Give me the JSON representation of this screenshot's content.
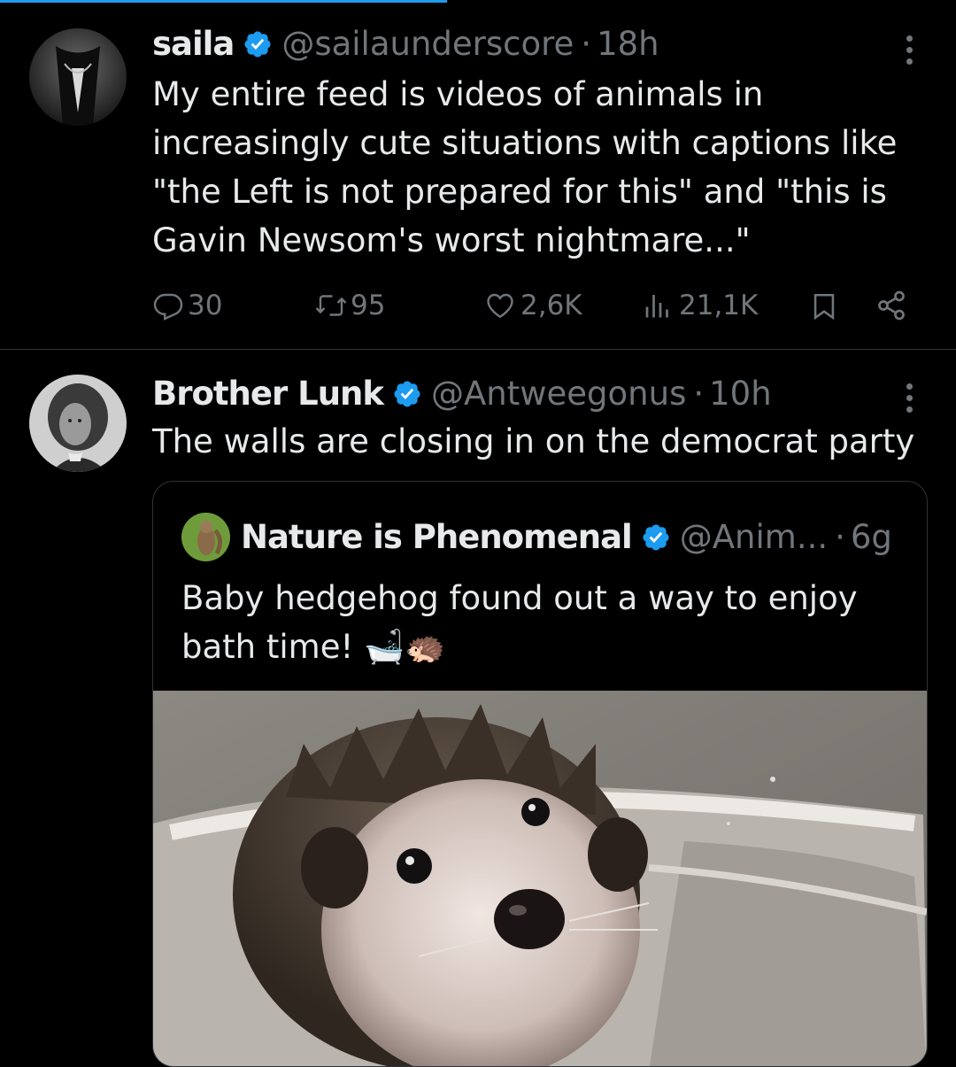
{
  "theme": {
    "background": "#000000",
    "accent": "#1d9bf0",
    "text": "#e7e9ea",
    "muted": "#71767b",
    "border": "#2f3336"
  },
  "tweets": [
    {
      "name": "saila",
      "handle": "@sailaunderscore",
      "separator": "·",
      "time": "18h",
      "verified_icon": "verified-badge-icon",
      "avatar": "avatar-icon",
      "text": "My entire feed is videos of animals in increasingly cute situations with captions like \"the Left is not prepared for this\" and \"this is Gavin Newsom's worst nightmare...\"",
      "actions": {
        "replies": "30",
        "retweets": "95",
        "likes": "2,6K",
        "views": "21,1K"
      }
    },
    {
      "name": "Brother Lunk",
      "handle": "@Antweegonus",
      "separator": "·",
      "time": "10h",
      "verified_icon": "verified-badge-icon",
      "avatar": "avatar-icon",
      "text": "The walls are closing in on the democrat party",
      "quote": {
        "name": "Nature is Phenomenal",
        "handle": "@Anim...",
        "separator": "·",
        "time": "6g",
        "text": "Baby hedgehog found out a way to enjoy bath time! 🛁🦔",
        "media": "hedgehog-bath-image"
      }
    }
  ]
}
